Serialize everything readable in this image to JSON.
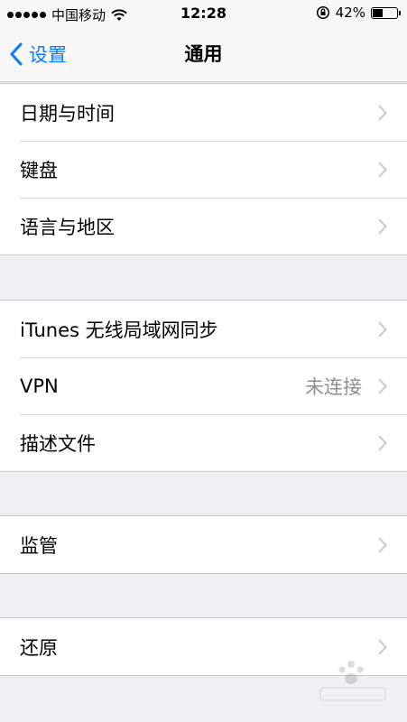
{
  "status_bar": {
    "carrier": "中国移动",
    "time": "12:28",
    "battery_text": "42%",
    "battery_level": 0.42
  },
  "nav": {
    "back_label": "设置",
    "title": "通用"
  },
  "groups": [
    {
      "rows": [
        {
          "label": "日期与时间"
        },
        {
          "label": "键盘"
        },
        {
          "label": "语言与地区"
        }
      ]
    },
    {
      "rows": [
        {
          "label": "iTunes 无线局域网同步"
        },
        {
          "label": "VPN",
          "value": "未连接"
        },
        {
          "label": "描述文件"
        }
      ]
    },
    {
      "rows": [
        {
          "label": "监管"
        }
      ]
    },
    {
      "rows": [
        {
          "label": "还原"
        }
      ]
    }
  ],
  "icons": {
    "back": "chevron-left-icon",
    "disclosure": "chevron-right-icon",
    "wifi": "wifi-icon",
    "rotation_lock": "rotation-lock-icon",
    "battery": "battery-icon"
  },
  "colors": {
    "accent": "#0a7aff",
    "background": "#efeff4",
    "secondary_text": "#8e8e93"
  }
}
